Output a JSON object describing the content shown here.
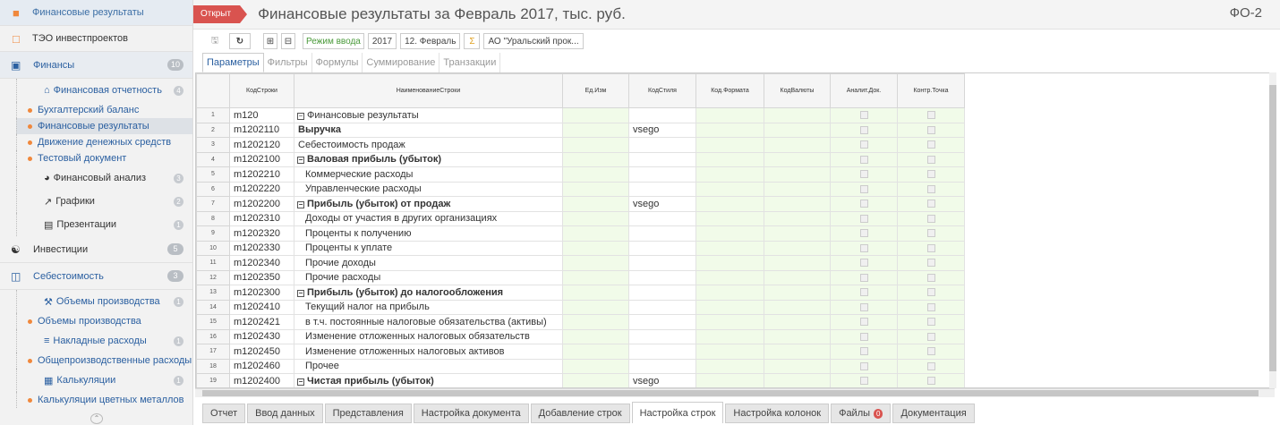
{
  "sidebar": {
    "top1": "Финансовые результаты",
    "top2": "ТЭО инвестпроектов",
    "finance": {
      "label": "Финансы",
      "count": "10"
    },
    "fin_report": {
      "label": "Финансовая отчетность",
      "count": "4"
    },
    "leaves": [
      "Бухгалтерский баланс",
      "Финансовые результаты",
      "Движение денежных средств",
      "Тестовый документ"
    ],
    "fin_analysis": {
      "label": "Финансовый анализ",
      "count": "3"
    },
    "charts": {
      "label": "Графики",
      "count": "2"
    },
    "presentations": {
      "label": "Презентации",
      "count": "1"
    },
    "investments": {
      "label": "Инвестиции",
      "count": "5"
    },
    "cost": {
      "label": "Себестоимость",
      "count": "3"
    },
    "prod_volume": {
      "label": "Объемы производства",
      "count": "1"
    },
    "prod_leaf": "Объемы производства",
    "overhead": {
      "label": "Накладные расходы",
      "count": "1"
    },
    "overhead_leaf": "Общепроизводственные расходы",
    "calc": {
      "label": "Калькуляции",
      "count": "1"
    },
    "calc_leaf": "Калькуляции цветных металлов"
  },
  "header": {
    "status": "Открыт",
    "title": "Финансовые результаты за Февраль 2017, тыс. руб.",
    "code": "ФО-2"
  },
  "toolbar": {
    "mode": "Режим ввода",
    "year": "2017",
    "month": "12. Февраль",
    "sigma": "Σ",
    "org": "АО \"Уральский прок..."
  },
  "tabs": [
    "Параметры",
    "Фильтры",
    "Формулы",
    "Суммирование",
    "Транзакции"
  ],
  "columns": [
    "КодСтроки",
    "НаименованиеСтроки",
    "Ед.Изм",
    "КодСтиля",
    "Код.Формата",
    "КодВалюты",
    "Аналит.Док.",
    "Контр.Точка"
  ],
  "rows": [
    {
      "n": "1",
      "code": "m120",
      "name": "Финансовые результаты",
      "style": "",
      "group": true,
      "bold": false,
      "indent": 0
    },
    {
      "n": "2",
      "code": "m1202110",
      "name": "Выручка",
      "style": "vsego",
      "group": false,
      "bold": true,
      "indent": 0
    },
    {
      "n": "3",
      "code": "m1202120",
      "name": "Себестоимость продаж",
      "style": "",
      "group": false,
      "bold": false,
      "indent": 0
    },
    {
      "n": "4",
      "code": "m1202100",
      "name": "Валовая прибыль (убыток)",
      "style": "",
      "group": true,
      "bold": true,
      "indent": 0
    },
    {
      "n": "5",
      "code": "m1202210",
      "name": "Коммерческие расходы",
      "style": "",
      "group": false,
      "bold": false,
      "indent": 1
    },
    {
      "n": "6",
      "code": "m1202220",
      "name": "Управленческие расходы",
      "style": "",
      "group": false,
      "bold": false,
      "indent": 1
    },
    {
      "n": "7",
      "code": "m1202200",
      "name": "Прибыль (убыток) от продаж",
      "style": "vsego",
      "group": true,
      "bold": true,
      "indent": 0
    },
    {
      "n": "8",
      "code": "m1202310",
      "name": "Доходы от участия в других организациях",
      "style": "",
      "group": false,
      "bold": false,
      "indent": 1
    },
    {
      "n": "9",
      "code": "m1202320",
      "name": "Проценты к получению",
      "style": "",
      "group": false,
      "bold": false,
      "indent": 1
    },
    {
      "n": "10",
      "code": "m1202330",
      "name": "Проценты к уплате",
      "style": "",
      "group": false,
      "bold": false,
      "indent": 1
    },
    {
      "n": "11",
      "code": "m1202340",
      "name": "Прочие доходы",
      "style": "",
      "group": false,
      "bold": false,
      "indent": 1
    },
    {
      "n": "12",
      "code": "m1202350",
      "name": "Прочие расходы",
      "style": "",
      "group": false,
      "bold": false,
      "indent": 1
    },
    {
      "n": "13",
      "code": "m1202300",
      "name": "Прибыль (убыток) до налогообложения",
      "style": "",
      "group": true,
      "bold": true,
      "indent": 0
    },
    {
      "n": "14",
      "code": "m1202410",
      "name": "Текущий налог на прибыль",
      "style": "",
      "group": false,
      "bold": false,
      "indent": 1
    },
    {
      "n": "15",
      "code": "m1202421",
      "name": "в т.ч. постоянные налоговые обязательства (активы)",
      "style": "",
      "group": false,
      "bold": false,
      "indent": 1
    },
    {
      "n": "16",
      "code": "m1202430",
      "name": "Изменение отложенных налоговых обязательств",
      "style": "",
      "group": false,
      "bold": false,
      "indent": 1
    },
    {
      "n": "17",
      "code": "m1202450",
      "name": "Изменение отложенных налоговых активов",
      "style": "",
      "group": false,
      "bold": false,
      "indent": 1
    },
    {
      "n": "18",
      "code": "m1202460",
      "name": "Прочее",
      "style": "",
      "group": false,
      "bold": false,
      "indent": 1
    },
    {
      "n": "19",
      "code": "m1202400",
      "name": "Чистая прибыль (убыток)",
      "style": "vsego",
      "group": true,
      "bold": true,
      "indent": 0
    }
  ],
  "bottom_tabs": [
    "Отчет",
    "Ввод данных",
    "Представления",
    "Настройка документа",
    "Добавление строк",
    "Настройка строк",
    "Настройка колонок",
    "Файлы",
    "Документация"
  ],
  "files_count": "0"
}
